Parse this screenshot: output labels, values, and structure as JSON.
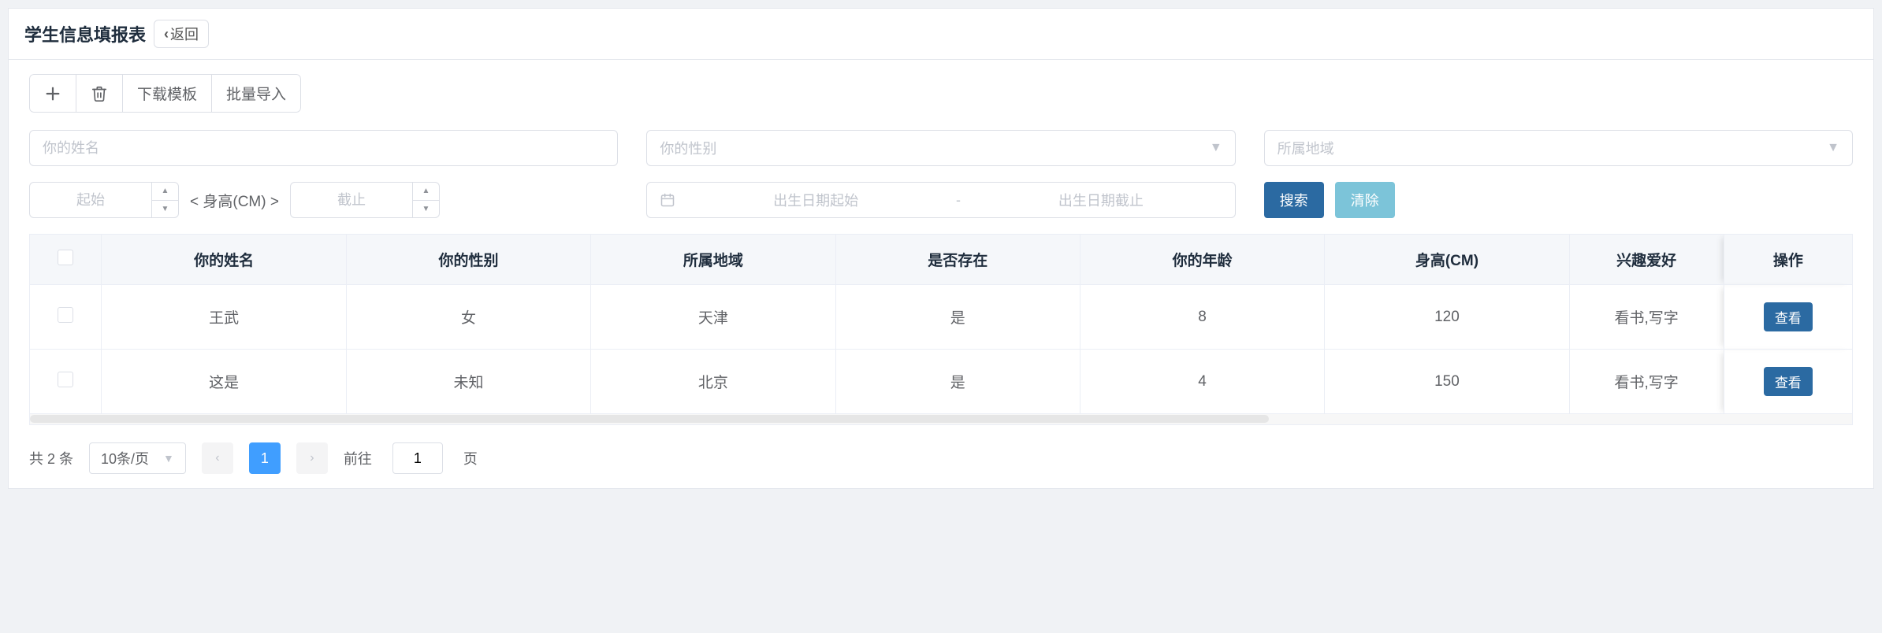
{
  "header": {
    "title": "学生信息填报表",
    "back_label": "返回"
  },
  "toolbar": {
    "download_template_label": "下载模板",
    "bulk_import_label": "批量导入"
  },
  "filters": {
    "name_placeholder": "你的姓名",
    "gender_placeholder": "你的性别",
    "region_placeholder": "所属地域",
    "height_from_placeholder": "起始",
    "height_label": "< 身高(CM) >",
    "height_to_placeholder": "截止",
    "birth_from_placeholder": "出生日期起始",
    "birth_range_sep": "-",
    "birth_to_placeholder": "出生日期截止",
    "search_label": "搜索",
    "clear_label": "清除"
  },
  "table": {
    "columns": [
      "你的姓名",
      "你的性别",
      "所属地域",
      "是否存在",
      "你的年龄",
      "身高(CM)",
      "兴趣爱好",
      "操作"
    ],
    "columns_display": [
      "你的姓名",
      "你的性别",
      "所属地域",
      "是否存在",
      "你的年龄",
      "身高(CM)",
      "兴趣爱好",
      "操作"
    ],
    "hobby_truncated": "兴趣爱好",
    "view_label": "查看",
    "rows": [
      {
        "name": "王武",
        "gender": "女",
        "region": "天津",
        "exists": "是",
        "age": "8",
        "height": "120",
        "hobby": "看书,写字"
      },
      {
        "name": "这是",
        "gender": "未知",
        "region": "北京",
        "exists": "是",
        "age": "4",
        "height": "150",
        "hobby": "看书,写字"
      }
    ]
  },
  "pager": {
    "total_text": "共 2 条",
    "page_size_label": "10条/页",
    "current_page": "1",
    "goto_prefix": "前往",
    "goto_value": "1",
    "goto_suffix": "页"
  }
}
